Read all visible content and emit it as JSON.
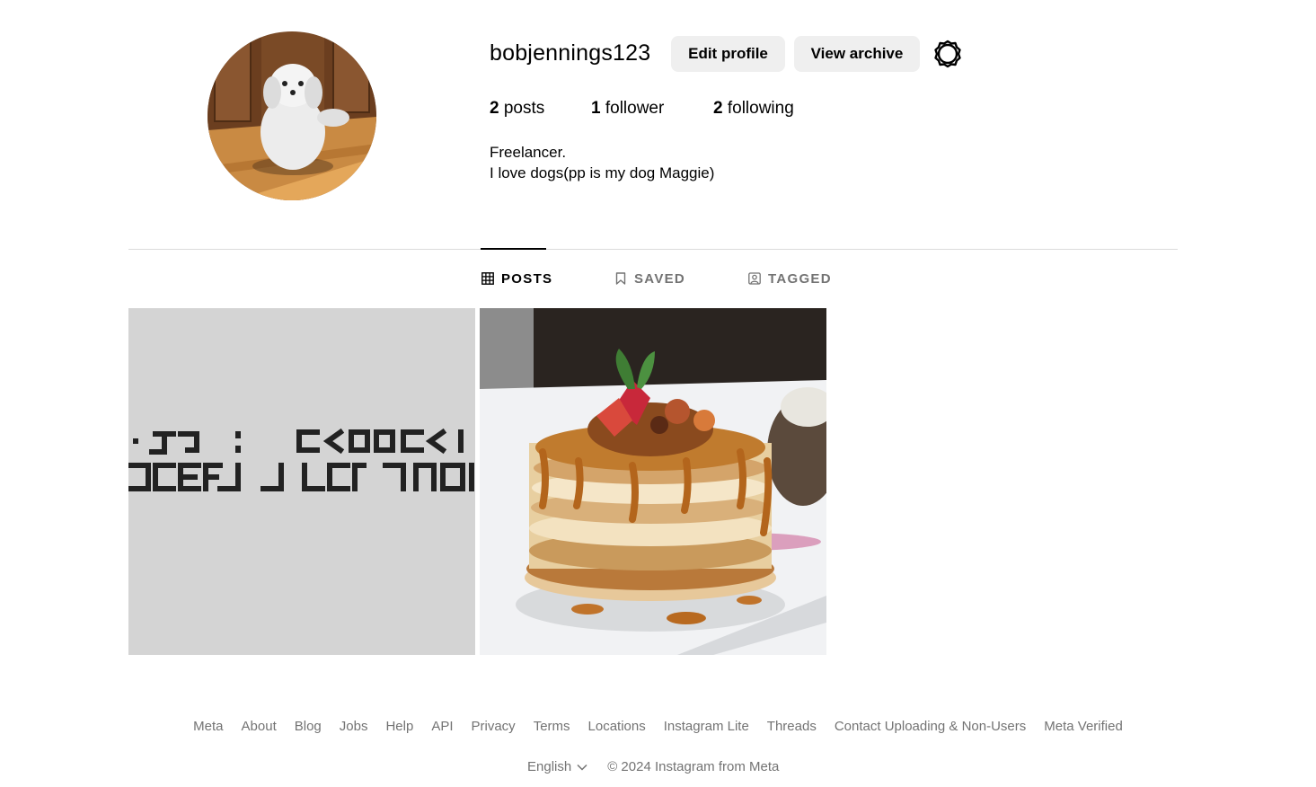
{
  "profile": {
    "username": "bobjennings123",
    "edit_label": "Edit profile",
    "archive_label": "View archive",
    "stats": {
      "posts_count": "2",
      "posts_label": " posts",
      "followers_count": "1",
      "followers_label": " follower",
      "following_count": "2",
      "following_label": " following"
    },
    "bio": {
      "line1": "Freelancer.",
      "line2": "I love dogs(pp is my dog Maggie)"
    }
  },
  "tabs": [
    {
      "label": "POSTS",
      "icon": "grid-icon",
      "active": true
    },
    {
      "label": "SAVED",
      "icon": "bookmark-icon",
      "active": false
    },
    {
      "label": "TAGGED",
      "icon": "tagged-user-icon",
      "active": false
    }
  ],
  "posts": [
    {
      "kind": "text-graphic"
    },
    {
      "kind": "pancakes-photo"
    }
  ],
  "footer": {
    "links": [
      "Meta",
      "About",
      "Blog",
      "Jobs",
      "Help",
      "API",
      "Privacy",
      "Terms",
      "Locations",
      "Instagram Lite",
      "Threads",
      "Contact Uploading & Non-Users",
      "Meta Verified"
    ],
    "language": "English",
    "copyright": "© 2024 Instagram from Meta"
  },
  "colors": {
    "button_bg": "#efefef",
    "secondary_text": "#737373",
    "divider": "#dbdbdb"
  }
}
